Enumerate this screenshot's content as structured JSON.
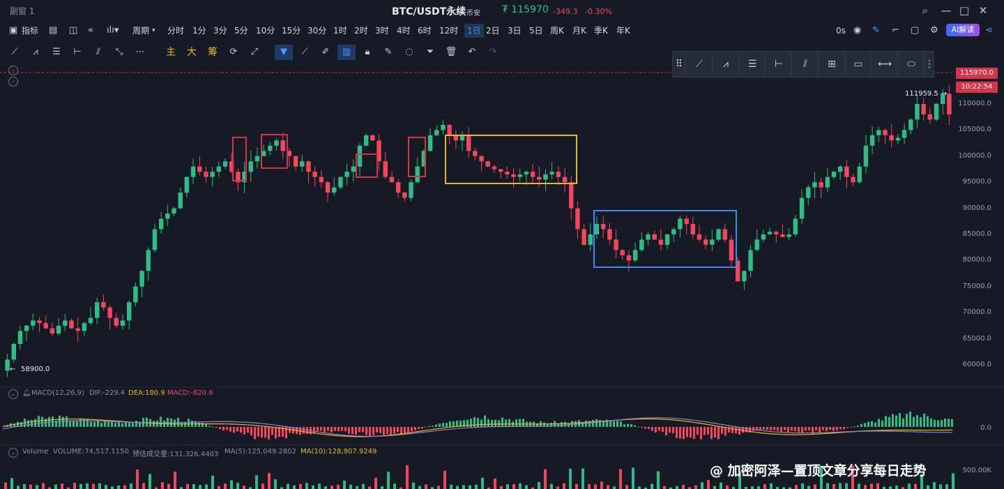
{
  "window": {
    "title": "副窗 1",
    "minimize": "—",
    "maximize": "□",
    "close": "✕"
  },
  "header": {
    "symbol": "BTC/USDT永续",
    "exchange": "币安",
    "price": "₮ 115970",
    "change": "-349.3",
    "change_pct": "-0.30%"
  },
  "toolbar": {
    "indicators_label": "指标",
    "period_label": "周期",
    "intervals": [
      "分时",
      "1分",
      "3分",
      "5分",
      "10分",
      "15分",
      "30分",
      "1时",
      "2时",
      "3时",
      "4时",
      "6时",
      "12时",
      "1日",
      "2日",
      "3日",
      "5日",
      "周K",
      "月K",
      "季K",
      "年K"
    ],
    "active_interval": "1日",
    "countdown": "0s",
    "ai_label": "AI解读"
  },
  "draw_tools": {
    "main_label": "主",
    "big_label": "大",
    "chip_label": "筹"
  },
  "price_axis": {
    "ticks": [
      "110000.0",
      "105000.0",
      "100000.0",
      "95000.0",
      "90000.0",
      "85000.0",
      "80000.0",
      "75000.0",
      "70000.0",
      "65000.0",
      "60000.0"
    ],
    "last_price": "115970.0",
    "countdown": "10:22:54"
  },
  "annotations": {
    "high": "111959.5",
    "low": "58900.0"
  },
  "macd": {
    "label": "MACD(12,26,9)",
    "dif": "DIF:-229.4",
    "dea": "DEA:180.9",
    "macd": "MACD:-820.6",
    "zero": "0.0"
  },
  "volume": {
    "label": "Volume",
    "value": "VOLUME:74,517.1150",
    "est": "预估成交量:131,326.4403",
    "ma5": "MA(5):125,049.2802",
    "ma10": "MA(10):128,907.9249",
    "tick": "500.00K"
  },
  "watermark": "@ 加密阿泽—置顶文章分享每日走势",
  "colors": {
    "up": "#2ebd85",
    "down": "#f6465d",
    "yellow_box": "#e8b923",
    "blue_box": "#3d8cf5",
    "red_box": "#d9334a"
  },
  "chart_data": {
    "type": "candlestick",
    "ylim": [
      55000,
      118000
    ],
    "box_annotations": [
      {
        "color": "yellow",
        "y": [
          95000,
          104000
        ]
      },
      {
        "color": "blue",
        "y": [
          78800,
          89700
        ]
      }
    ],
    "closes": [
      61000,
      64000,
      66500,
      67500,
      68500,
      68000,
      67000,
      66000,
      67500,
      68500,
      67000,
      66500,
      68000,
      69000,
      72000,
      71000,
      69000,
      67500,
      68500,
      72000,
      75000,
      78000,
      82000,
      86000,
      88000,
      89000,
      90000,
      93000,
      96000,
      98000,
      97000,
      96000,
      97000,
      98000,
      99000,
      97000,
      95000,
      97000,
      99000,
      100000,
      101000,
      102000,
      103000,
      101000,
      100000,
      98000,
      99000,
      97000,
      96000,
      95000,
      93000,
      94000,
      96000,
      97000,
      98000,
      102000,
      104000,
      103000,
      99000,
      96000,
      95000,
      93000,
      92000,
      95000,
      98000,
      101000,
      104000,
      105000,
      106000,
      104000,
      103000,
      104000,
      101000,
      100000,
      99000,
      98000,
      97500,
      97000,
      96500,
      96000,
      96500,
      97000,
      96000,
      95500,
      96500,
      97000,
      96000,
      95000,
      90000,
      86000,
      83000,
      85000,
      87000,
      86000,
      84000,
      82000,
      81000,
      80000,
      82000,
      84000,
      85000,
      84000,
      83000,
      85000,
      86000,
      88000,
      87000,
      85000,
      84000,
      83000,
      84000,
      86000,
      84000,
      80000,
      76000,
      78000,
      82000,
      84000,
      85000,
      85500,
      85000,
      84500,
      85000,
      88000,
      92000,
      94000,
      95000,
      94000,
      96000,
      97000,
      98000,
      96000,
      95000,
      98000,
      102000,
      104000,
      105000,
      104000,
      103000,
      103500,
      105000,
      107000,
      110000,
      108000,
      107000,
      110000,
      111959.5,
      108000
    ]
  }
}
